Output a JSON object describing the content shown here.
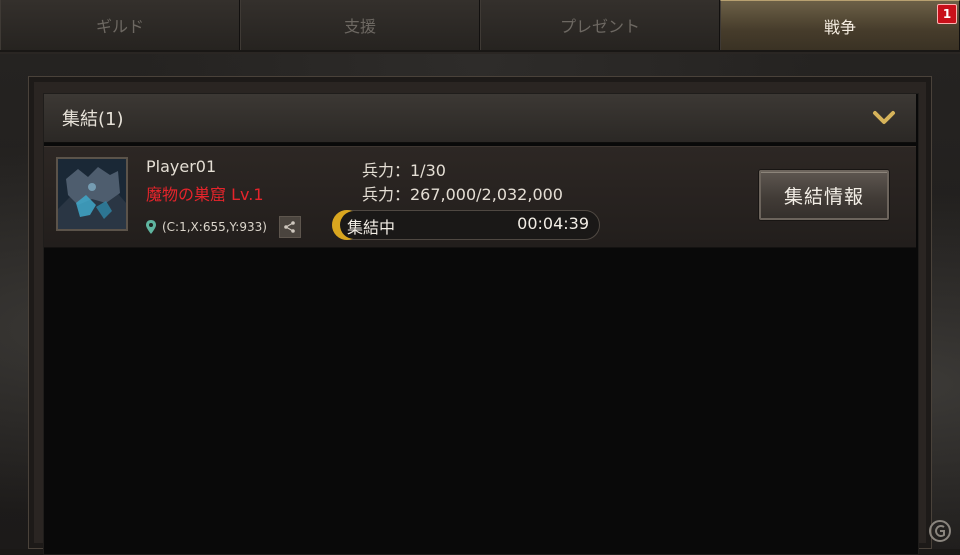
{
  "tabs": [
    {
      "label": "ギルド",
      "active": false
    },
    {
      "label": "支援",
      "active": false
    },
    {
      "label": "プレゼント",
      "active": false
    },
    {
      "label": "戦争",
      "active": true,
      "badge": "1"
    }
  ],
  "section": {
    "title": "集結(1)",
    "toggle_icon": "chevron-down-icon"
  },
  "rally": {
    "player": "Player01",
    "target": "魔物の巣窟 Lv.1",
    "coords": "(C:1,X:655,Y:933)",
    "troops_count": "兵力：1/30",
    "troops_power": "兵力：267,000/2,032,000",
    "status": "集結中",
    "timer": "00:04:39",
    "info_button": "集結情報"
  },
  "colors": {
    "accent_gold": "#d9a61f",
    "target_red": "#e5242b",
    "badge_red": "#c8101a"
  }
}
